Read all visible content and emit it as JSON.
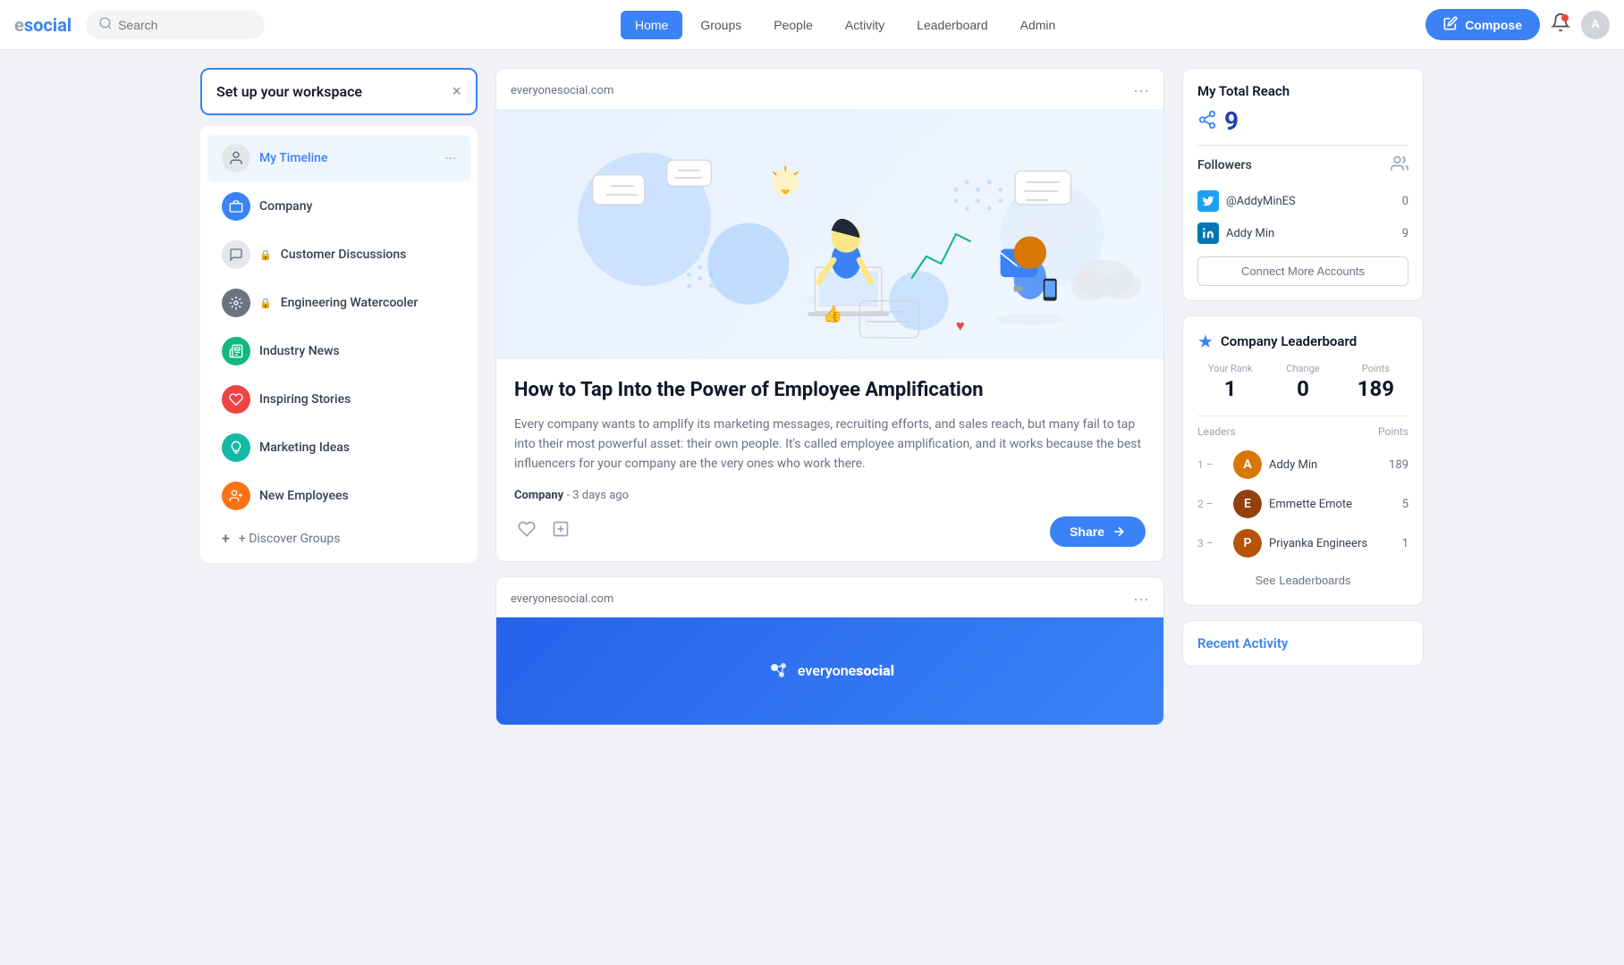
{
  "brand": {
    "name_prefix": "e",
    "name_main": "social",
    "full": "esocial"
  },
  "topnav": {
    "search_placeholder": "Search",
    "links": [
      {
        "label": "Home",
        "active": true
      },
      {
        "label": "Groups",
        "active": false
      },
      {
        "label": "People",
        "active": false
      },
      {
        "label": "Activity",
        "active": false
      },
      {
        "label": "Leaderboard",
        "active": false
      },
      {
        "label": "Admin",
        "active": false
      }
    ],
    "compose_label": "Compose"
  },
  "sidebar": {
    "workspace_title": "Set up your workspace",
    "items": [
      {
        "label": "My Timeline",
        "active": true,
        "icon_type": "avatar",
        "color": "#6b7280"
      },
      {
        "label": "Company",
        "active": false,
        "icon_type": "company",
        "color": "#3b82f6"
      },
      {
        "label": "Customer Discussions",
        "active": false,
        "icon_type": "lock",
        "color": "#6b7280",
        "locked": true
      },
      {
        "label": "Engineering Watercooler",
        "active": false,
        "icon_type": "lock",
        "color": "#6b7280",
        "locked": true
      },
      {
        "label": "Industry News",
        "active": false,
        "icon_type": "news",
        "color": "#10b981"
      },
      {
        "label": "Inspiring Stories",
        "active": false,
        "icon_type": "inspire",
        "color": "#ef4444"
      },
      {
        "label": "Marketing Ideas",
        "active": false,
        "icon_type": "marketing",
        "color": "#14b8a6"
      },
      {
        "label": "New Employees",
        "active": false,
        "icon_type": "employee",
        "color": "#f97316"
      }
    ],
    "discover_label": "+ Discover Groups"
  },
  "feed": {
    "posts": [
      {
        "source": "everyonesocial.com",
        "title": "How to Tap Into the Power of Employee Amplification",
        "excerpt": "Every company wants to amplify its marketing messages, recruiting efforts, and sales reach, but many fail to tap into their most powerful asset: their own people. It's called employee amplification, and it works because the best influencers for your company are the very ones who work there.",
        "category": "Company",
        "time_ago": "3 days ago",
        "share_label": "Share"
      },
      {
        "source": "everyonesocial.com",
        "title": "",
        "excerpt": "",
        "category": "",
        "time_ago": "",
        "share_label": ""
      }
    ]
  },
  "right_panel": {
    "total_reach": {
      "title": "My Total Reach",
      "count": 9,
      "followers_label": "Followers",
      "accounts": [
        {
          "name": "@AddyMinES",
          "platform": "twitter",
          "count": 0
        },
        {
          "name": "Addy Min",
          "platform": "linkedin",
          "count": 9
        }
      ],
      "connect_more_label": "Connect More Accounts"
    },
    "leaderboard": {
      "title": "Company Leaderboard",
      "your_rank_label": "--",
      "rank_label": "Your Rank",
      "rank_value": "1",
      "change_label": "Change",
      "change_value": "0",
      "points_label": "Points",
      "points_value": "189",
      "leaders_label": "Leaders",
      "leaders_points_label": "Points",
      "leaders": [
        {
          "rank": "1",
          "dash": "–",
          "name": "Addy Min",
          "points": 189,
          "color": "#d97706"
        },
        {
          "rank": "2",
          "dash": "–",
          "name": "Emmette Emote",
          "points": 5,
          "color": "#92400e"
        },
        {
          "rank": "3",
          "dash": "–",
          "name": "Priyanka Engineers",
          "points": 1,
          "color": "#b45309"
        }
      ],
      "see_leaderboards_label": "See Leaderboards"
    },
    "recent_activity": {
      "title": "Recent Activity"
    }
  }
}
